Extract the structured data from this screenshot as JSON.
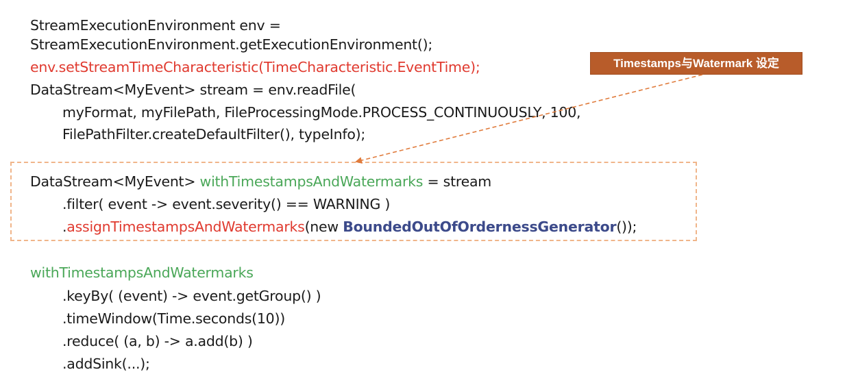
{
  "code": {
    "setup": [
      {
        "text": "StreamExecutionEnvironment env ="
      },
      {
        "text": "StreamExecutionEnvironment.getExecutionEnvironment();"
      },
      {
        "text": "env.setStreamTimeCharacteristic(TimeCharacteristic.EventTime);"
      },
      {
        "text": "DataStream<MyEvent> stream = env.readFile("
      },
      {
        "text": "myFormat, myFilePath, FileProcessingMode.PROCESS_CONTINUOUSLY, 100,"
      },
      {
        "text": "FilePathFilter.createDefaultFilter(), typeInfo);"
      }
    ],
    "boxed": {
      "line1_prefix": "DataStream<MyEvent> ",
      "line1_var": "withTimestampsAndWatermarks",
      "line1_suffix": " = stream",
      "line2": ".filter( event -> event.severity() == WARNING )",
      "line3_dot": ".",
      "line3_method": "assignTimestampsAndWatermarks",
      "line3_mid": "(new ",
      "line3_class": "BoundedOutOfOrdernessGenerator",
      "line3_end": "());"
    },
    "pipeline": {
      "var": "withTimestampsAndWatermarks",
      "steps": [
        {
          "text": ".keyBy( (event) -> event.getGroup() )"
        },
        {
          "text": ".timeWindow(Time.seconds(10))"
        },
        {
          "text": ".reduce( (a, b) -> a.add(b) )"
        },
        {
          "text": ".addSink(...);"
        }
      ]
    }
  },
  "callout": {
    "label": "Timestamps与Watermark 设定"
  },
  "colors": {
    "keyword_red": "#e03a2f",
    "variable_green": "#4aa758",
    "class_navy": "#3c4a8a",
    "callout_bg": "#b85c2a",
    "dash_border": "#f0b58a",
    "arrow": "#e07b3c"
  }
}
